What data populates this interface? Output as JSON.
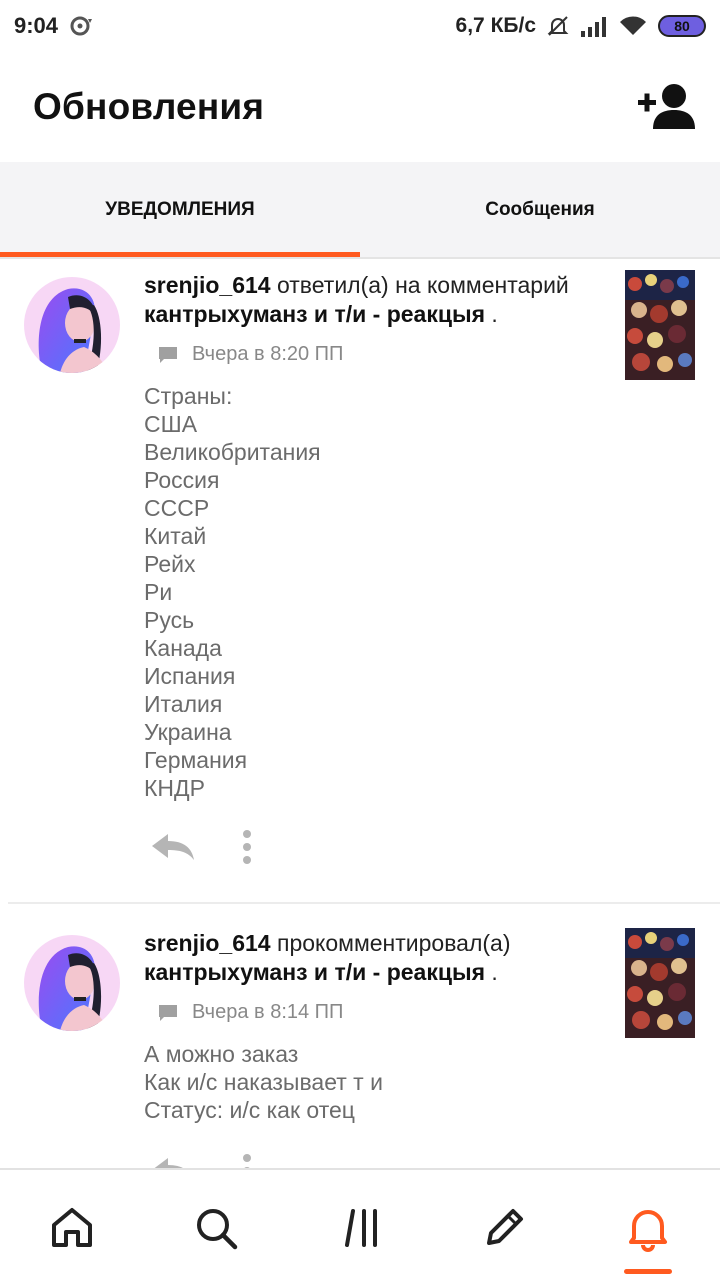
{
  "status_bar": {
    "time": "9:04",
    "speed": "6,7 КБ/с",
    "battery": "80"
  },
  "header": {
    "title": "Обновления",
    "add_user_icon": "add-user-icon"
  },
  "tabs": [
    {
      "label": "УВЕДОМЛЕНИЯ",
      "active": true
    },
    {
      "label": "Сообщения",
      "active": false
    }
  ],
  "notifications": [
    {
      "user": "srenjio_614",
      "action": " ответил(а) на комментарий",
      "story": "кантрыхуманз и т/и - реакцыя",
      "suffix": " .",
      "time": "Вчера в 8:20 ПП",
      "lines": [
        "Страны:",
        "США",
        "Великобритания",
        "Россия",
        "СССР",
        "Китай",
        "Рейх",
        "Ри",
        "Русь",
        "Канада",
        "Испания",
        "Италия",
        "Украина",
        "Германия",
        "КНДР"
      ]
    },
    {
      "user": "srenjio_614",
      "action": " прокомментировал(а)",
      "story": "кантрыхуманз и т/и - реакцыя",
      "suffix": " .",
      "time": "Вчера в 8:14 ПП",
      "lines": [
        "А можно заказ",
        "Как и/с наказывает т и",
        "Статус: и/с как отец"
      ]
    }
  ],
  "bottom_nav": [
    "home-icon",
    "search-icon",
    "library-icon",
    "write-icon",
    "notifications-bell-icon"
  ],
  "colors": {
    "accent": "#ff5a1f",
    "tabs_bg": "#f4f4f6",
    "text_secondary": "#6b6b6b"
  }
}
